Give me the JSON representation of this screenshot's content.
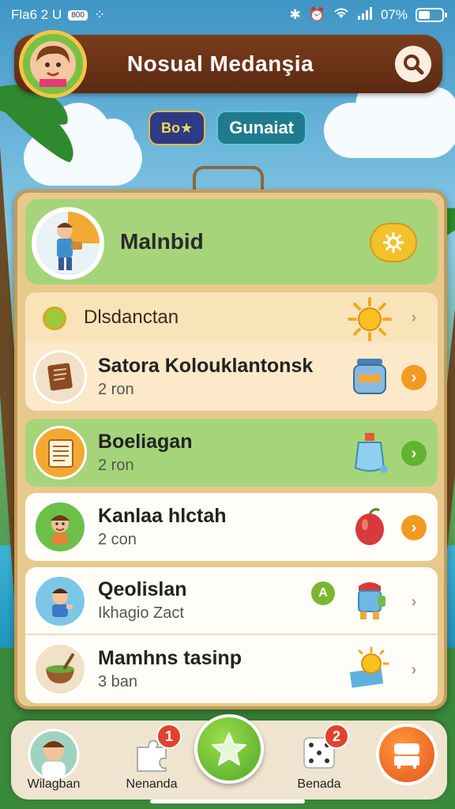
{
  "status_bar": {
    "time": "Fla6 2 U",
    "badge": "800",
    "battery": "07%"
  },
  "header": {
    "title": "Nosual Medanşia"
  },
  "chips": {
    "coins": "Bo★",
    "mode": "Gunaiat"
  },
  "featured": {
    "name": "Malnbid"
  },
  "section": {
    "title": "Dlsdanctan"
  },
  "items": [
    {
      "title": "Satora Kolouklantonsk",
      "subtitle": "2 ron"
    },
    {
      "title": "Boeliagan",
      "subtitle": "2 ron"
    },
    {
      "title": "Kanlaa hlctah",
      "subtitle": "2 con"
    },
    {
      "title": "Qeolislan",
      "subtitle": "Ikhagio Zact"
    },
    {
      "title": "Mamhns tasinp",
      "subtitle": "3 ban"
    }
  ],
  "mini_badge": "A",
  "bottom_nav": {
    "item1": "Wilagban",
    "item2": "Nenanda",
    "item2_badge": "1",
    "item3": "Benada",
    "item3_badge": "2"
  },
  "colors": {
    "header_bg": "#6a3217",
    "panel_bg": "#e8c98d",
    "green_row": "#a6d47a",
    "cream_row": "#fbe9c9",
    "orange_arrow": "#f29a22",
    "green_arrow": "#62b330"
  }
}
